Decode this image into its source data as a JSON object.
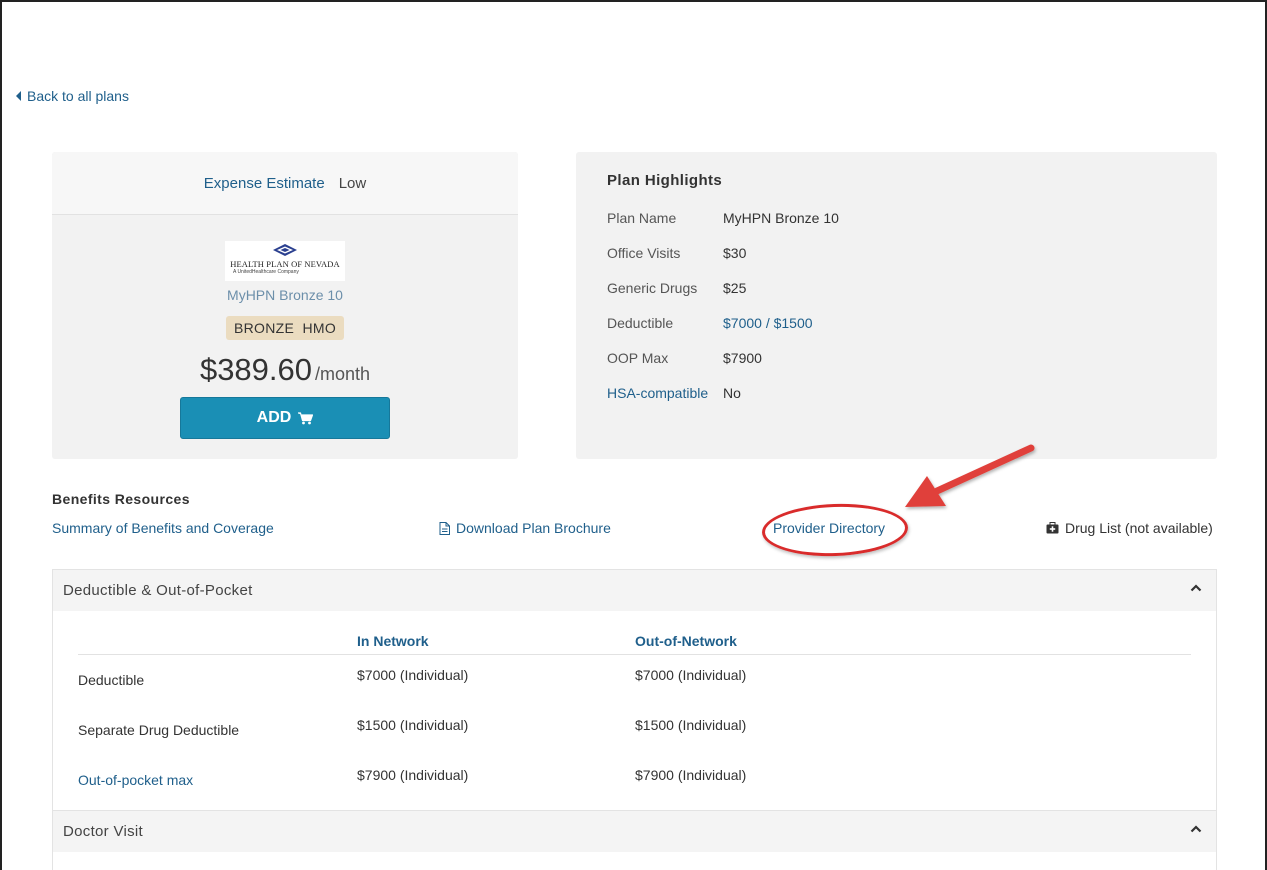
{
  "nav": {
    "back_label": "Back to all plans"
  },
  "plan_card": {
    "expense_label": "Expense Estimate",
    "expense_value": "Low",
    "logo_text": "HEALTH PLAN OF NEVADA",
    "logo_subtext": "A UnitedHealthcare Company",
    "plan_name": "MyHPN Bronze 10",
    "metal_tier": "BRONZE",
    "plan_type": "HMO",
    "price": "$389.60",
    "price_unit": "/month",
    "add_label": "ADD",
    "add_icon": "cart-icon",
    "brand_color": "#1a8fb5"
  },
  "highlights": {
    "title": "Plan Highlights",
    "rows": [
      {
        "label": "Plan Name",
        "value": "MyHPN Bronze 10"
      },
      {
        "label": "Office Visits",
        "value": "$30"
      },
      {
        "label": "Generic Drugs",
        "value": "$25"
      },
      {
        "label": "Deductible",
        "value": "$7000 / $1500"
      },
      {
        "label": "OOP Max",
        "value": "$7900"
      },
      {
        "label": "HSA-compatible",
        "value": "No"
      }
    ]
  },
  "resources": {
    "title": "Benefits Resources",
    "sbc_label": "Summary of Benefits and Coverage",
    "brochure_label": "Download Plan Brochure",
    "provider_label": "Provider Directory",
    "drug_label": "Drug List (not available)"
  },
  "annotation": {
    "color": "#d92b2b",
    "target": "Provider Directory"
  },
  "deductible_section": {
    "title": "Deductible & Out-of-Pocket",
    "col_in": "In Network",
    "col_out": "Out-of-Network",
    "rows": [
      {
        "label": "Deductible",
        "in": "$7000 (Individual)",
        "out": "$7000 (Individual)"
      },
      {
        "label": "Separate Drug Deductible",
        "in": "$1500 (Individual)",
        "out": "$1500 (Individual)"
      },
      {
        "label": "Out-of-pocket max",
        "in": "$7900 (Individual)",
        "out": "$7900 (Individual)"
      }
    ]
  },
  "doctor_section": {
    "title": "Doctor Visit"
  }
}
